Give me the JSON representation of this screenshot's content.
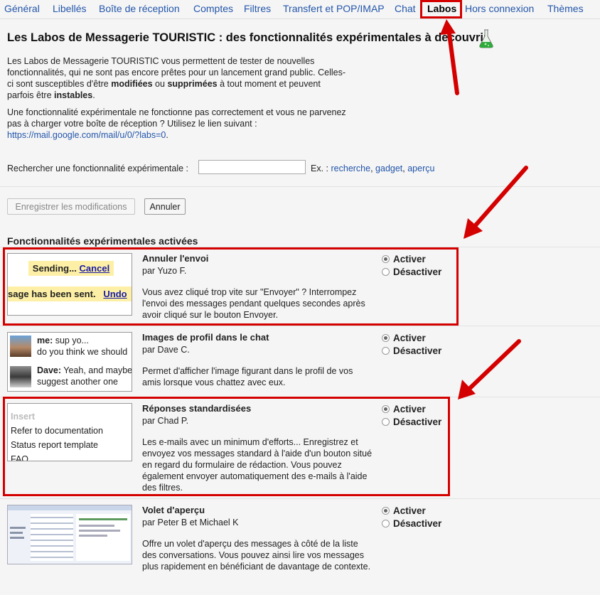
{
  "tabs": [
    "Général",
    "Libellés",
    "Boîte de réception",
    "Comptes",
    "Filtres",
    "Transfert et POP/IMAP",
    "Chat",
    "Labos",
    "Hors connexion",
    "Thèmes"
  ],
  "page_title": "Les Labos de Messagerie TOURISTIC : des fonctionnalités expérimentales à découvrir",
  "intro": {
    "p1a": "Les Labos de Messagerie TOURISTIC vous permettent de tester de nouvelles",
    "p1b": "fonctionnalités, qui ne sont pas encore prêtes pour un lancement grand public. Celles-",
    "p1c_pre": "ci sont susceptibles d'être ",
    "p1c_b1": "modifiées",
    "p1c_mid": " ou ",
    "p1c_b2": "supprimées",
    "p1c_post": " à tout moment et peuvent",
    "p1d_pre": "parfois être ",
    "p1d_b": "instables",
    "p1d_post": ".",
    "p2a": "Une fonctionnalité expérimentale ne fonctionne pas correctement et vous ne parvenez",
    "p2b": "pas à charger votre boîte de réception ? Utilisez le lien suivant :",
    "p2_link": "https://mail.google.com/mail/u/0/?labs=0",
    "p2_end": "."
  },
  "search": {
    "label": "Rechercher une fonctionnalité expérimentale :",
    "value": "",
    "ex_label": "Ex. :",
    "examples": [
      "recherche",
      "gadget",
      "aperçu"
    ]
  },
  "buttons": {
    "save": "Enregistrer les modifications",
    "cancel": "Annuler"
  },
  "section_title": "Fonctionnalités expérimentales activées",
  "radio": {
    "on": "Activer",
    "off": "Désactiver"
  },
  "labs": [
    {
      "name": "Annuler l'envoi",
      "author": "par Yuzo F.",
      "desc": "Vous avez cliqué trop vite sur \"Envoyer\" ? Interrompez l'envoi des messages pendant quelques secondes après avoir cliqué sur le bouton Envoyer.",
      "thumb": {
        "sending": "Sending...",
        "cancel": "Cancel",
        "sent": "sage has been sent.",
        "undo": "Undo"
      }
    },
    {
      "name": "Images de profil dans le chat",
      "author": "par Dave C.",
      "desc": "Permet d'afficher l'image figurant dans le profil de vos amis lorsque vous chattez avec eux.",
      "thumb": {
        "chat1_name": "me:",
        "chat1_a": " sup yo...",
        "chat1_b": "do you think we should",
        "chat2_name": "Dave:",
        "chat2_a": " Yeah, and maybe",
        "chat2_b": "suggest another one"
      }
    },
    {
      "name": "Réponses standardisées",
      "author": "par Chad P.",
      "desc": "Les e-mails avec un minimum d'efforts... Enregistrez et envoyez vos messages standard à l'aide d'un bouton situé en regard du formulaire de rédaction. Vous pouvez également envoyer automatiquement des e-mails à l'aide des filtres.",
      "thumb": {
        "insert": "Insert",
        "items": [
          "Refer to documentation",
          "Status report template",
          "FAQ"
        ]
      }
    },
    {
      "name": "Volet d'aperçu",
      "author": "par Peter B et Michael K",
      "desc": "Offre un volet d'aperçu des messages à côté de la liste des conversations. Vous pouvez ainsi lire vos messages plus rapidement en bénéficiant de davantage de contexte."
    }
  ],
  "colors": {
    "link": "#2255aa",
    "highlight": "#d40000",
    "note_yellow": "#fdf0a6"
  }
}
